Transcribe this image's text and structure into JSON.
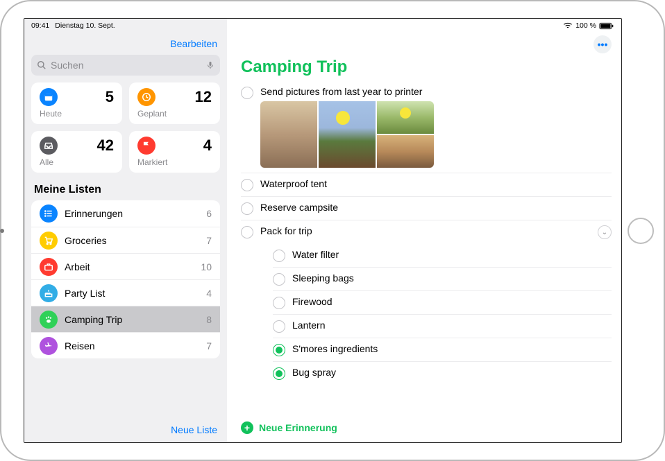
{
  "status": {
    "time": "09:41",
    "date": "Dienstag 10. Sept.",
    "wifi": "wifi",
    "battery_pct": "100 %"
  },
  "sidebar": {
    "edit": "Bearbeiten",
    "search_placeholder": "Suchen",
    "cards": [
      {
        "id": "heute",
        "label": "Heute",
        "count": 5,
        "icon": "calendar",
        "color": "#0a84ff"
      },
      {
        "id": "geplant",
        "label": "Geplant",
        "count": 12,
        "icon": "clock",
        "color": "#ff9500"
      },
      {
        "id": "alle",
        "label": "Alle",
        "count": 42,
        "icon": "tray",
        "color": "#5b5b60"
      },
      {
        "id": "markiert",
        "label": "Markiert",
        "count": 4,
        "icon": "flag",
        "color": "#ff3b30"
      }
    ],
    "section_title": "Meine Listen",
    "lists": [
      {
        "name": "Erinnerungen",
        "count": 6,
        "color": "#0a84ff",
        "icon": "list"
      },
      {
        "name": "Groceries",
        "count": 7,
        "color": "#ffcc00",
        "icon": "cart"
      },
      {
        "name": "Arbeit",
        "count": 10,
        "color": "#ff3b30",
        "icon": "briefcase"
      },
      {
        "name": "Party List",
        "count": 4,
        "color": "#32ade6",
        "icon": "cake"
      },
      {
        "name": "Camping Trip",
        "count": 8,
        "color": "#30d158",
        "icon": "paw",
        "selected": true
      },
      {
        "name": "Reisen",
        "count": 7,
        "color": "#af52de",
        "icon": "plane"
      }
    ],
    "new_list": "Neue Liste"
  },
  "main": {
    "title": "Camping Trip",
    "accent": "#11c15b",
    "more_icon": "ellipsis",
    "tasks": [
      {
        "label": "Send pictures from last year to printer",
        "done": false,
        "has_images": true
      },
      {
        "label": "Waterproof tent",
        "done": false
      },
      {
        "label": "Reserve campsite",
        "done": false
      },
      {
        "label": "Pack for trip",
        "done": false,
        "expandable": true,
        "subtasks": [
          {
            "label": "Water filter",
            "done": false
          },
          {
            "label": "Sleeping bags",
            "done": false
          },
          {
            "label": "Firewood",
            "done": false
          },
          {
            "label": "Lantern",
            "done": false
          },
          {
            "label": "S'mores ingredients",
            "done": true
          },
          {
            "label": "Bug spray",
            "done": true
          }
        ]
      }
    ],
    "new_reminder": "Neue Erinnerung"
  }
}
